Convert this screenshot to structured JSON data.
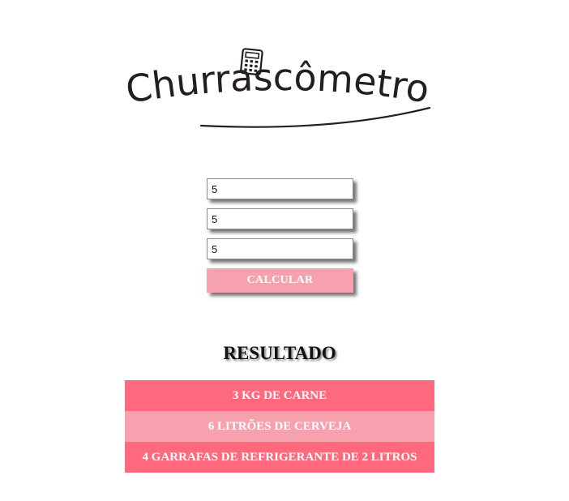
{
  "header": {
    "logo_text": "Churrascômetro"
  },
  "form": {
    "fields": [
      {
        "value": "5"
      },
      {
        "value": "5"
      },
      {
        "value": "5"
      }
    ],
    "calculate_label": "CALCULAR"
  },
  "result": {
    "title": "RESULTADO",
    "items": [
      "3 KG DE CARNE",
      "6 LITRÕES DE CERVEJA",
      "4 GARRAFAS DE REFRIGERANTE DE 2 LITROS"
    ]
  },
  "colors": {
    "accent_dark": "#ff697e",
    "accent_light": "#f7a1ae",
    "text": "#231f1e"
  },
  "icons": {
    "logo_icon": "calculator-icon"
  }
}
